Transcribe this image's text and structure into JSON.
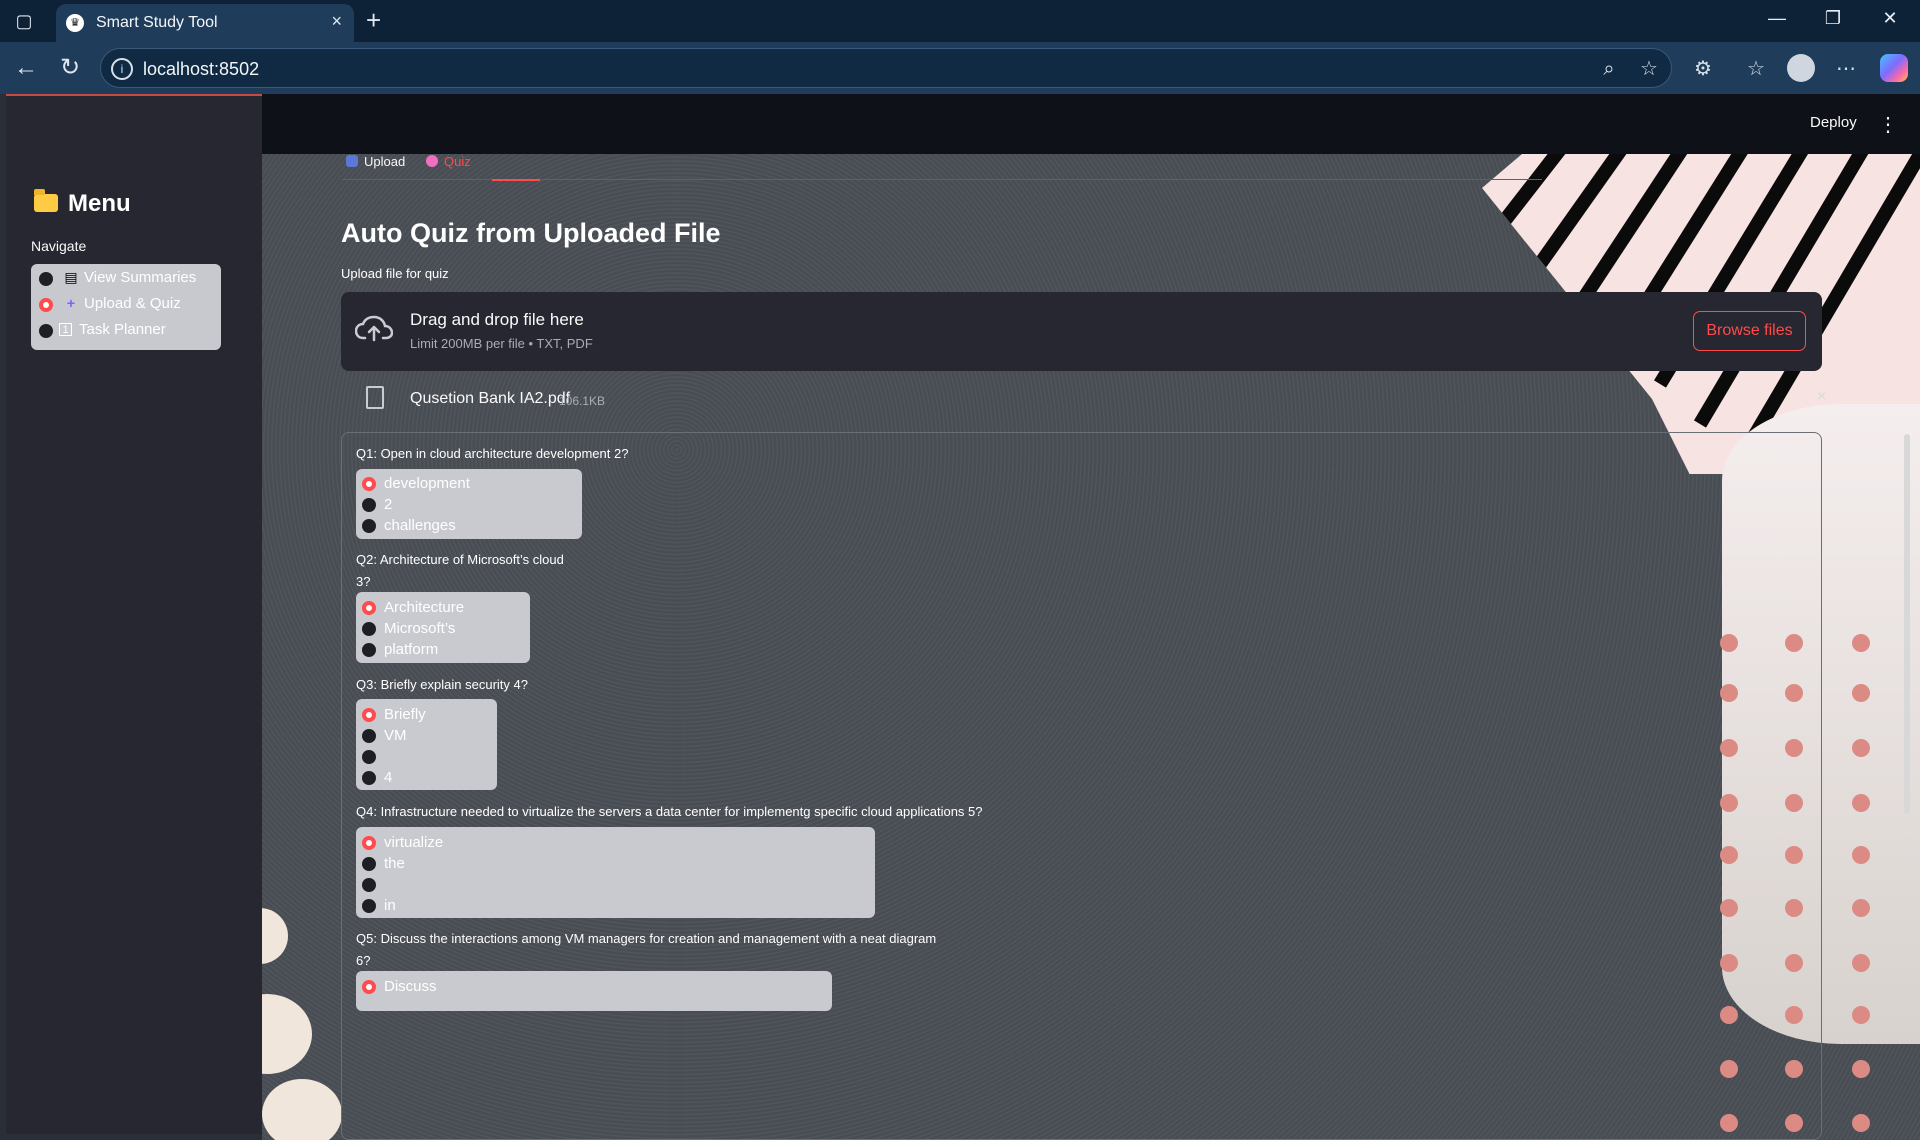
{
  "browser": {
    "tab_title": "Smart Study Tool",
    "url": "localhost:8502",
    "window_controls": [
      "minimize",
      "restore",
      "close"
    ]
  },
  "app": {
    "header": {
      "deploy_label": "Deploy"
    },
    "sidebar": {
      "menu_title": "Menu",
      "navigate_label": "Navigate",
      "items": [
        {
          "label": "View Summaries",
          "icon": "document-icon",
          "selected": false
        },
        {
          "label": "Upload & Quiz",
          "icon": "plus-icon",
          "selected": true
        },
        {
          "label": "Task Planner",
          "icon": "number-1-icon",
          "selected": false
        }
      ]
    },
    "tabs": [
      {
        "label": "Upload",
        "active": false
      },
      {
        "label": "Quiz",
        "active": true
      }
    ],
    "main": {
      "title": "Auto Quiz from Uploaded File",
      "uploader": {
        "label": "Upload file for quiz",
        "drop_text": "Drag and drop file here",
        "limit_text": "Limit 200MB per file • TXT, PDF",
        "browse_label": "Browse files",
        "file": {
          "name": "Qusetion Bank IA2.pdf",
          "size": "106.1KB"
        }
      },
      "questions": [
        {
          "prompt": "Q1:  Open in cloud architecture development 2?",
          "options": [
            "development",
            "2",
            "challenges"
          ],
          "selected_index": 0
        },
        {
          "prompt": "Q2:  Architecture of Microsoft’s cloud\n3?",
          "options": [
            "Architecture",
            "Microsoft’s",
            "platform"
          ],
          "selected_index": 0
        },
        {
          "prompt": "Q3:  Briefly explain security 4?",
          "options": [
            "Briefly",
            "VM",
            "",
            "4"
          ],
          "selected_index": 0
        },
        {
          "prompt": "Q4:  Infrastructure needed to virtualize the servers a data center for implementg specific cloud applications 5?",
          "options": [
            "virtualize",
            "the",
            "",
            "in"
          ],
          "selected_index": 0
        },
        {
          "prompt": "Q5:  Discuss the interactions among VM managers for creation and management with a neat diagram\n6?",
          "options": [
            "Discuss"
          ],
          "selected_index": 0
        }
      ]
    }
  },
  "colors": {
    "accent": "#ff4b4b",
    "sidebar_bg": "#262730",
    "header_bg": "#0e1117",
    "choice_bg": "#c8cacf"
  }
}
